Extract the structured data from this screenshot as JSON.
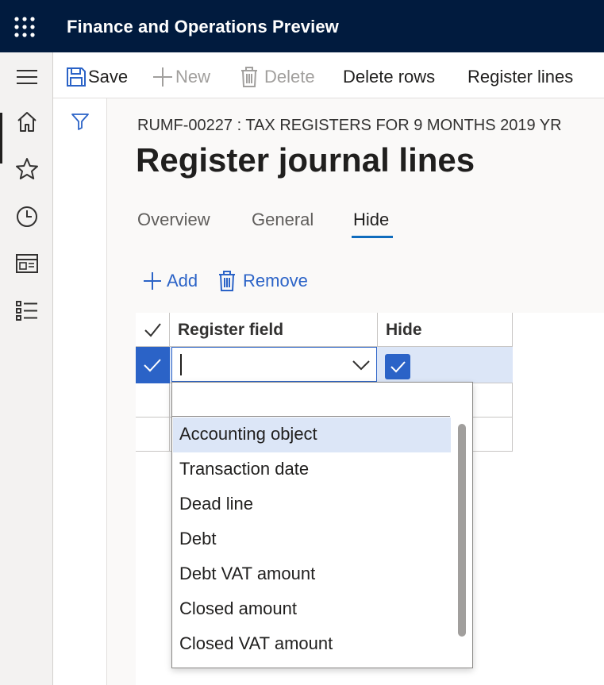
{
  "app": {
    "title": "Finance and Operations Preview"
  },
  "nav": {
    "icons": [
      "hamburger-icon",
      "home-icon",
      "star-icon",
      "clock-icon",
      "workspace-icon",
      "list-icon"
    ]
  },
  "actions": {
    "save": "Save",
    "new": "New",
    "delete": "Delete",
    "delete_rows": "Delete rows",
    "register_lines": "Register lines"
  },
  "page": {
    "caption": "RUMF-00227 : TAX REGISTERS FOR 9 MONTHS 2019 YR",
    "title": "Register journal lines"
  },
  "tabs": [
    {
      "label": "Overview",
      "active": false
    },
    {
      "label": "General",
      "active": false
    },
    {
      "label": "Hide",
      "active": true
    }
  ],
  "grid": {
    "add": "Add",
    "remove": "Remove",
    "columns": [
      "Register field",
      "Hide"
    ],
    "selected_row": {
      "register_field": "",
      "hide": true
    }
  },
  "dropdown": {
    "search_value": "",
    "options": [
      "Accounting object",
      "Transaction date",
      "Dead line",
      "Debt",
      "Debt VAT amount",
      "Closed amount",
      "Closed VAT amount"
    ],
    "highlighted": "Accounting object"
  },
  "colors": {
    "appbar": "#011b3e",
    "accent": "#2b63c7",
    "selected_row": "#dce6f7"
  }
}
